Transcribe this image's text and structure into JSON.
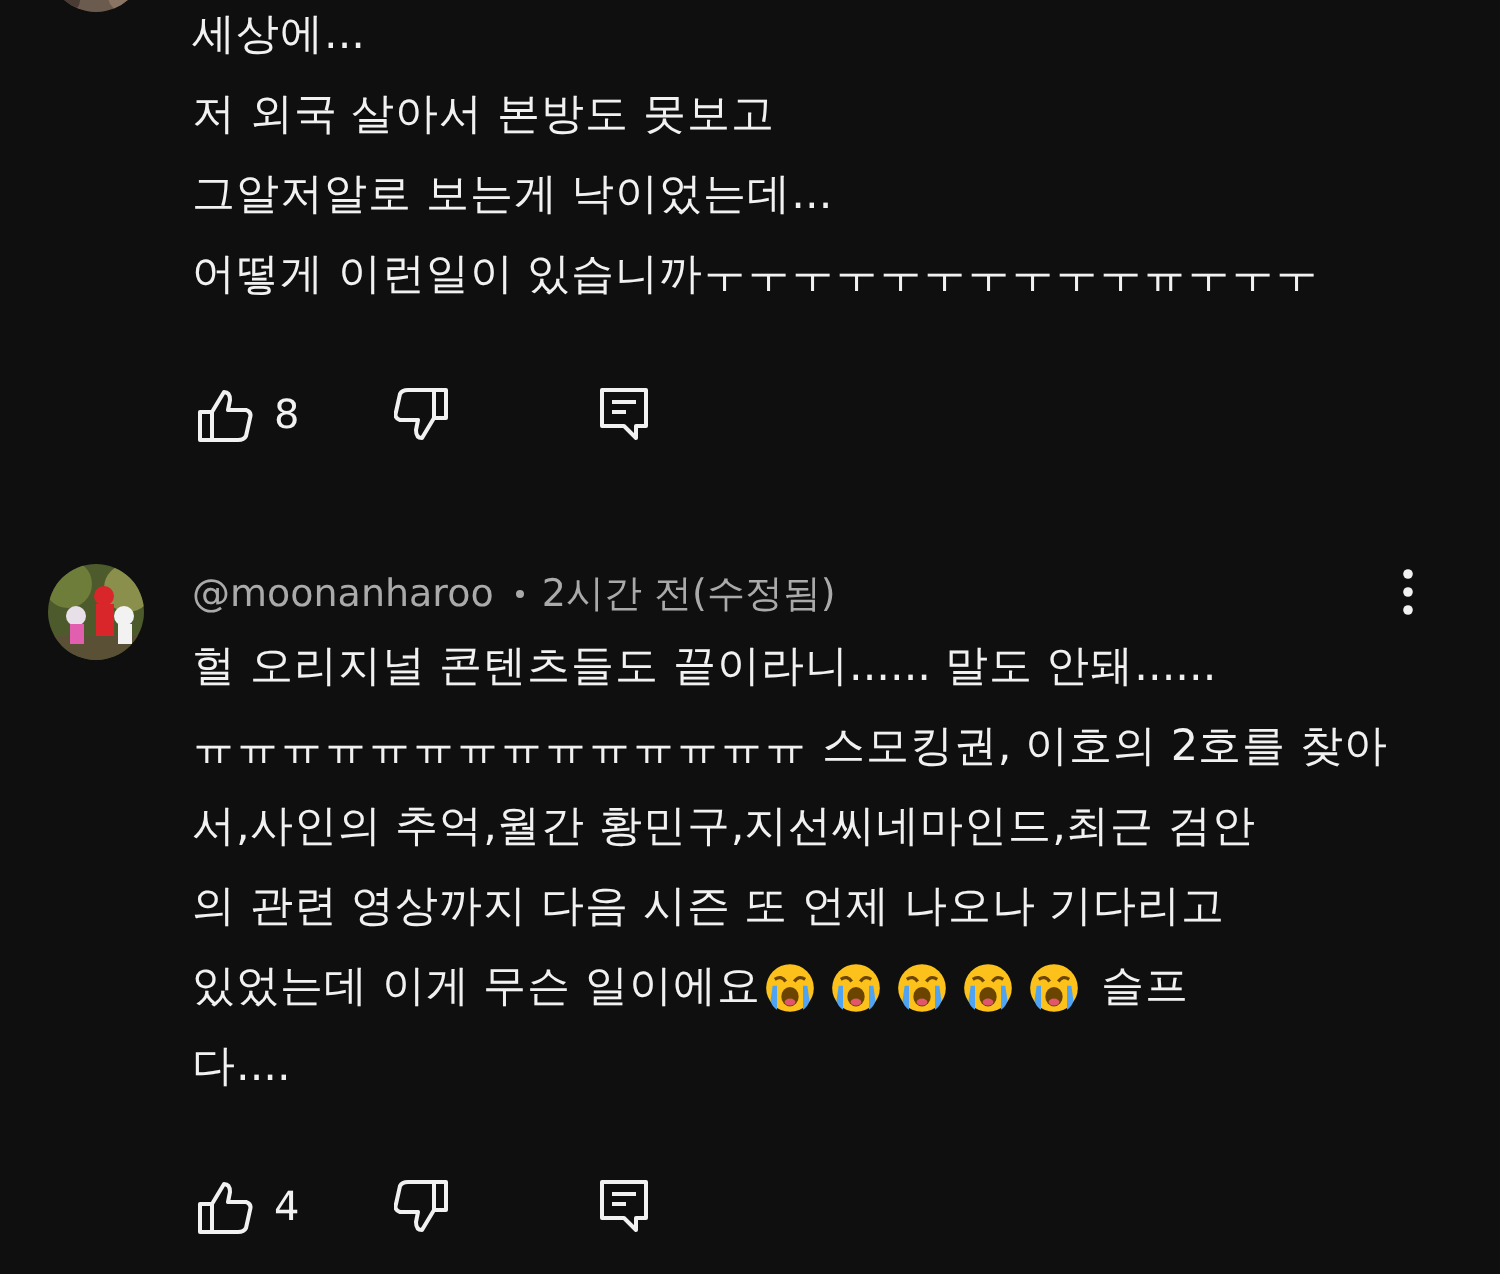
{
  "comments": [
    {
      "lines": [
        {
          "segments": [
            {
              "kind": "text",
              "text": "세상에..."
            }
          ]
        },
        {
          "segments": [
            {
              "kind": "text",
              "text": "저 외국 살아서 본방도 못보고"
            }
          ]
        },
        {
          "segments": [
            {
              "kind": "text",
              "text": "그알저알로 보는게 낙이었는데..."
            }
          ]
        },
        {
          "segments": [
            {
              "kind": "text",
              "text": "어떻게 이런일이 있습니까ㅜㅜㅜㅜㅜㅜㅜㅜㅜㅜㅠㅜㅜㅜ"
            }
          ]
        }
      ],
      "likes": "8"
    },
    {
      "author": "@moonanharoo",
      "meta": "2시간 전(수정됨)",
      "lines": [
        {
          "segments": [
            {
              "kind": "text",
              "text": "헐 오리지널 콘텐츠들도 끝이라니...... 말도 안돼......"
            }
          ]
        },
        {
          "segments": [
            {
              "kind": "text",
              "text": "ㅠㅠㅠㅠㅠㅠㅠㅠㅠㅠㅠㅠㅠㅠ 스모킹권, 이호의 2호를 찾아"
            }
          ]
        },
        {
          "segments": [
            {
              "kind": "text",
              "text": "서,사인의 추억,월간 황민구,지선씨네마인드,최근 검안"
            }
          ]
        },
        {
          "segments": [
            {
              "kind": "text",
              "text": "의 관련 영상까지 다음 시즌 또 언제 나오나 기다리고"
            }
          ]
        },
        {
          "segments": [
            {
              "kind": "text",
              "text": "있었는데 이게 무슨 일이에요"
            },
            {
              "kind": "emoji"
            },
            {
              "kind": "emoji"
            },
            {
              "kind": "emoji"
            },
            {
              "kind": "emoji"
            },
            {
              "kind": "emoji"
            },
            {
              "kind": "text",
              "text": "슬프"
            }
          ]
        },
        {
          "segments": [
            {
              "kind": "text",
              "text": "다...."
            }
          ]
        }
      ],
      "likes": "4"
    }
  ]
}
